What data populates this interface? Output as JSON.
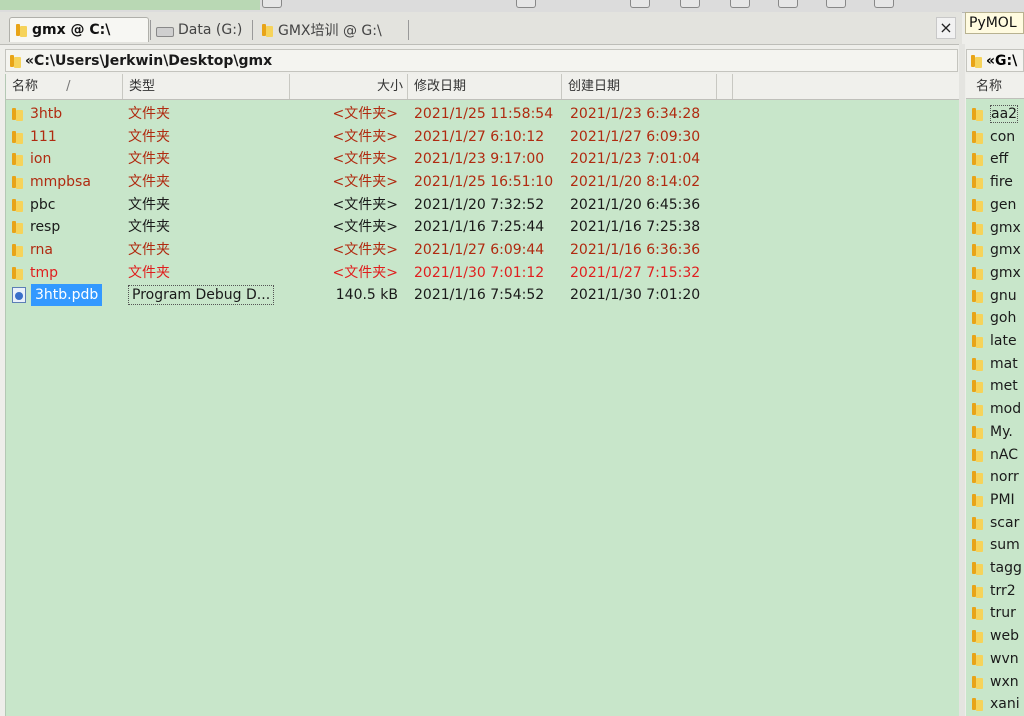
{
  "window": {
    "right_label": "PyMOL"
  },
  "tabs": [
    {
      "label": "gmx @ C:\\",
      "active": true
    },
    {
      "label": "Data (G:)",
      "active": false
    },
    {
      "label": "GMX培训 @ G:\\",
      "active": false
    }
  ],
  "close_label": "×",
  "left_panel": {
    "path": "«C:\\Users\\Jerkwin\\Desktop\\gmx",
    "columns": {
      "name": "名称",
      "type": "类型",
      "size": "大小",
      "modified": "修改日期",
      "created": "创建日期"
    },
    "sort_indicator": "/",
    "rows": [
      {
        "name": "3htb",
        "type": "文件夹",
        "size": "<文件夹>",
        "modified": "2021/1/25 11:58:54",
        "created": "2021/1/23 6:34:28"
      },
      {
        "name": "111",
        "type": "文件夹",
        "size": "<文件夹>",
        "modified": "2021/1/27 6:10:12",
        "created": "2021/1/27 6:09:30"
      },
      {
        "name": "ion",
        "type": "文件夹",
        "size": "<文件夹>",
        "modified": "2021/1/23 9:17:00",
        "created": "2021/1/23 7:01:04"
      },
      {
        "name": "mmpbsa",
        "type": "文件夹",
        "size": "<文件夹>",
        "modified": "2021/1/25 16:51:10",
        "created": "2021/1/20 8:14:02"
      },
      {
        "name": "pbc",
        "type": "文件夹",
        "size": "<文件夹>",
        "modified": "2021/1/20 7:32:52",
        "created": "2021/1/20 6:45:36"
      },
      {
        "name": "resp",
        "type": "文件夹",
        "size": "<文件夹>",
        "modified": "2021/1/16 7:25:44",
        "created": "2021/1/16 7:25:38"
      },
      {
        "name": "rna",
        "type": "文件夹",
        "size": "<文件夹>",
        "modified": "2021/1/27 6:09:44",
        "created": "2021/1/16 6:36:36"
      },
      {
        "name": "tmp",
        "type": "文件夹",
        "size": "<文件夹>",
        "modified": "2021/1/30 7:01:12",
        "created": "2021/1/27 7:15:32"
      },
      {
        "name": "3htb.pdb",
        "type": "Program Debug D...",
        "size": "140.5 kB",
        "modified": "2021/1/16 7:54:52",
        "created": "2021/1/30 7:01:20"
      }
    ]
  },
  "right_panel": {
    "path": "«G:\\",
    "column_name": "名称",
    "items": [
      "aa2",
      "con",
      "eff",
      "fire",
      "gen",
      "gmx",
      "gmx",
      "gmx",
      "gnu",
      "goh",
      "late",
      "mat",
      "met",
      "mod",
      "My.",
      "nAC",
      "norr",
      "PMI",
      "scar",
      "sum",
      "tagg",
      "trr2",
      "trur",
      "web",
      "wvn",
      "wxn",
      "xani"
    ]
  },
  "colors": {
    "list_bg": "#c8e6ca",
    "folder_text_recent": "#b02a10",
    "folder_text_normal": "#1a1a1a",
    "folder_text_newest": "#e01e1e",
    "selection": "#3399ff"
  }
}
